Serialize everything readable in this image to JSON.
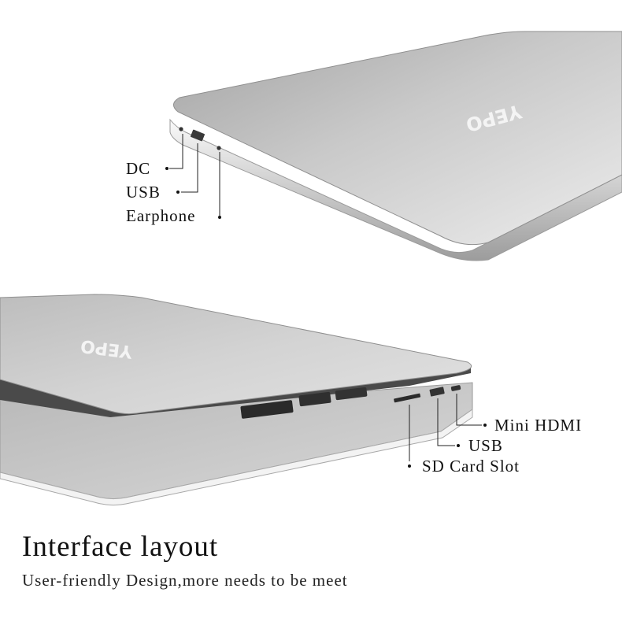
{
  "brand": {
    "logo_text": "YEPO"
  },
  "top_laptop": {
    "ports": [
      {
        "label": "DC"
      },
      {
        "label": "USB"
      },
      {
        "label": "Earphone"
      }
    ]
  },
  "bottom_laptop": {
    "ports": [
      {
        "label": "Mini HDMI"
      },
      {
        "label": "USB"
      },
      {
        "label": "SD Card Slot"
      }
    ]
  },
  "caption": {
    "title": "Interface layout",
    "subtitle": "User-friendly Design,more needs to be meet"
  },
  "colors": {
    "aluminum_light": "#e6e6e6",
    "aluminum_dark": "#9a9a9a",
    "text": "#111111"
  }
}
